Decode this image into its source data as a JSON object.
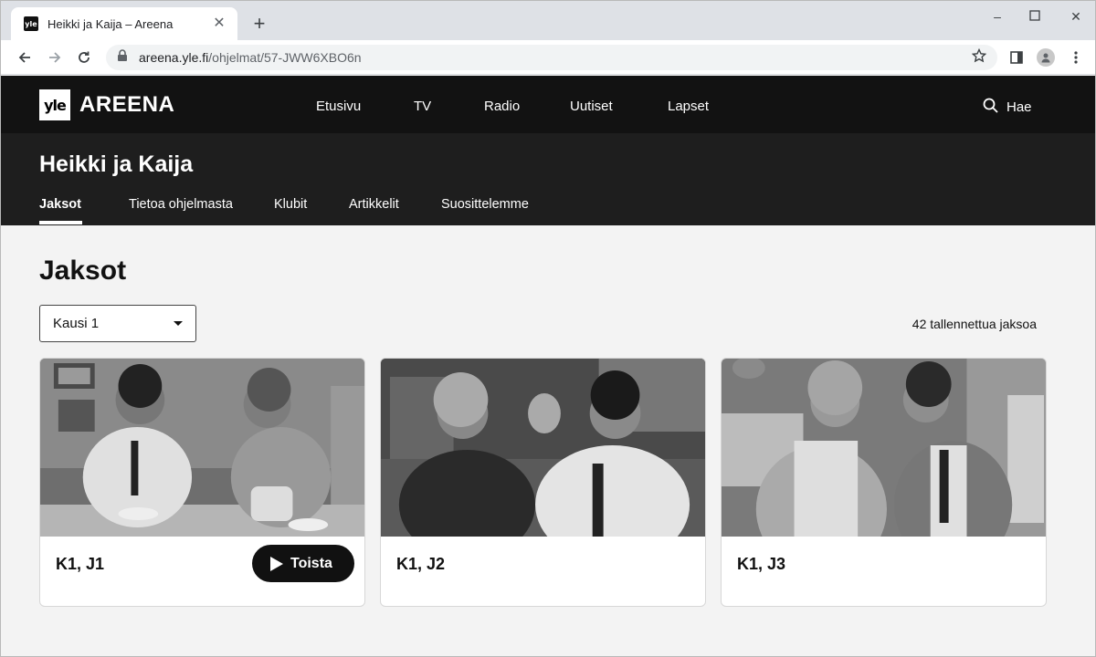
{
  "browser": {
    "tab_title": "Heikki ja Kaija – Areena",
    "favicon_text": "yle",
    "url_host": "areena.yle.fi",
    "url_path": "/ohjelmat/57-JWW6XBO6n",
    "icons": [
      "back-icon",
      "forward-icon",
      "reload-icon",
      "lock-icon",
      "star-icon",
      "sidepanel-icon",
      "profile-icon",
      "menu-icon",
      "minimize-icon",
      "maximize-icon",
      "close-icon"
    ]
  },
  "site": {
    "logo_box": "yle",
    "logo_text": "AREENA",
    "nav": [
      "Etusivu",
      "TV",
      "Radio",
      "Uutiset",
      "Lapset"
    ],
    "search_label": "Hae"
  },
  "program": {
    "title": "Heikki ja Kaija",
    "tabs": [
      "Jaksot",
      "Tietoa ohjelmasta",
      "Klubit",
      "Artikkelit",
      "Suosittelemme"
    ],
    "active_tab": "Jaksot"
  },
  "episodes": {
    "heading": "Jaksot",
    "season_selected": "Kausi 1",
    "count_text": "42 tallennettua jaksoa",
    "play_label": "Toista",
    "cards": [
      {
        "label": "K1, J1"
      },
      {
        "label": "K1, J2"
      },
      {
        "label": "K1, J3"
      }
    ]
  },
  "colors": {
    "header_bg": "#121212",
    "program_bg": "#1e1e1e",
    "content_bg": "#f3f3f3",
    "play_bg": "#111111"
  }
}
